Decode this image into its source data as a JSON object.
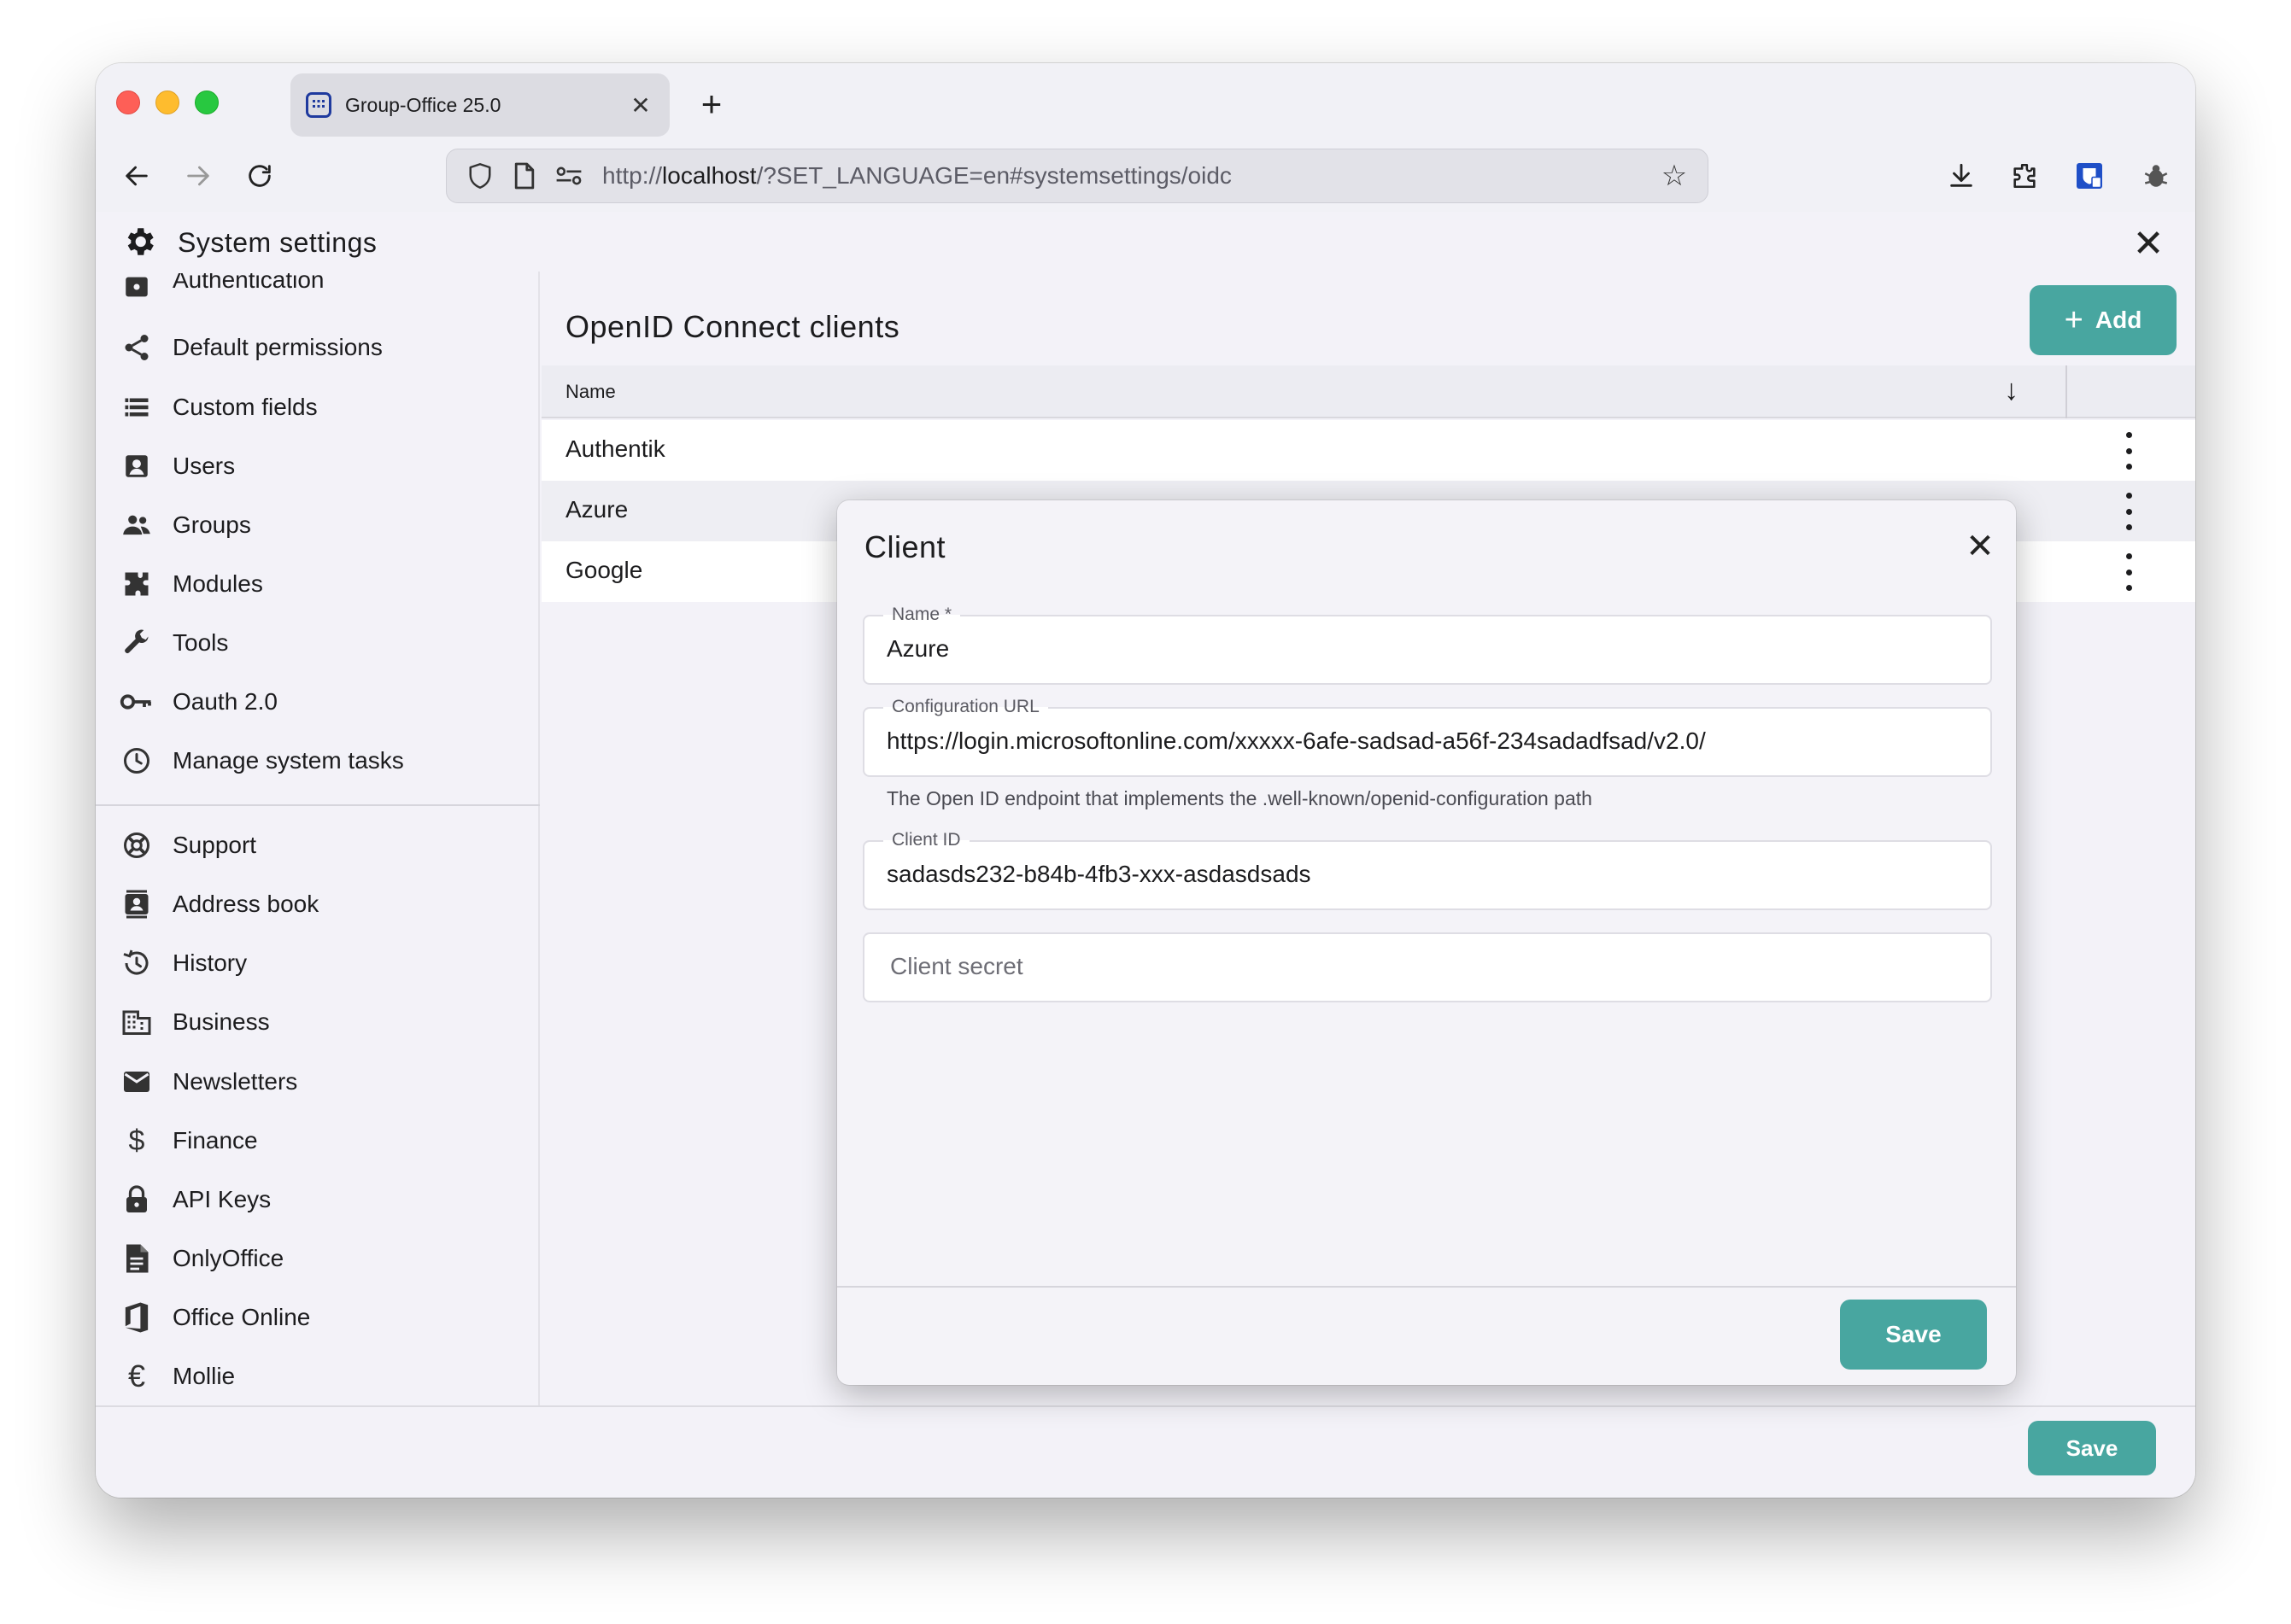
{
  "browser": {
    "tab_title": "Group-Office 25.0",
    "tab_favicon": "calendar-icon",
    "url_prefix": "http://",
    "url_host": "localhost",
    "url_path": "/?SET_LANGUAGE=en#systemsettings/oidc"
  },
  "app": {
    "title": "System settings"
  },
  "sidebar": {
    "items": [
      {
        "label": "Authentication",
        "icon": "authentication-icon"
      },
      {
        "label": "Default permissions",
        "icon": "share-icon"
      },
      {
        "label": "Custom fields",
        "icon": "list-icon"
      },
      {
        "label": "Users",
        "icon": "user-icon"
      },
      {
        "label": "Groups",
        "icon": "group-icon"
      },
      {
        "label": "Modules",
        "icon": "puzzle-icon"
      },
      {
        "label": "Tools",
        "icon": "wrench-icon"
      },
      {
        "label": "Oauth 2.0",
        "icon": "key-icon"
      },
      {
        "label": "Manage system tasks",
        "icon": "clock-icon"
      }
    ],
    "modules": [
      {
        "label": "Support",
        "icon": "lifebuoy-icon"
      },
      {
        "label": "Address book",
        "icon": "address-book-icon"
      },
      {
        "label": "History",
        "icon": "history-icon"
      },
      {
        "label": "Business",
        "icon": "building-icon"
      },
      {
        "label": "Newsletters",
        "icon": "mail-icon"
      },
      {
        "label": "Finance",
        "icon": "dollar-icon"
      },
      {
        "label": "API Keys",
        "icon": "lock-icon"
      },
      {
        "label": "OnlyOffice",
        "icon": "document-icon"
      },
      {
        "label": "Office Online",
        "icon": "office-icon"
      },
      {
        "label": "Mollie",
        "icon": "euro-icon"
      }
    ]
  },
  "content": {
    "title": "OpenID Connect clients",
    "add_label": "Add",
    "column_name": "Name",
    "rows": [
      "Authentik",
      "Azure",
      "Google"
    ]
  },
  "footer": {
    "save_label": "Save"
  },
  "modal": {
    "title": "Client",
    "name_label": "Name *",
    "name_value": "Azure",
    "config_url_label": "Configuration URL",
    "config_url_value": "https://login.microsoftonline.com/xxxxx-6afe-sadsad-a56f-234sadadfsad/v2.0/",
    "config_url_hint": "The Open ID endpoint that implements the .well-known/openid-configuration path",
    "client_id_label": "Client ID",
    "client_id_value": "sadasds232-b84b-4fb3-xxx-asdasdsads",
    "client_secret_placeholder": "Client secret",
    "save_label": "Save"
  },
  "colors": {
    "accent": "#48a6a0",
    "window_bg": "#f1f1f6",
    "modal_bg": "#f4f3f8"
  }
}
